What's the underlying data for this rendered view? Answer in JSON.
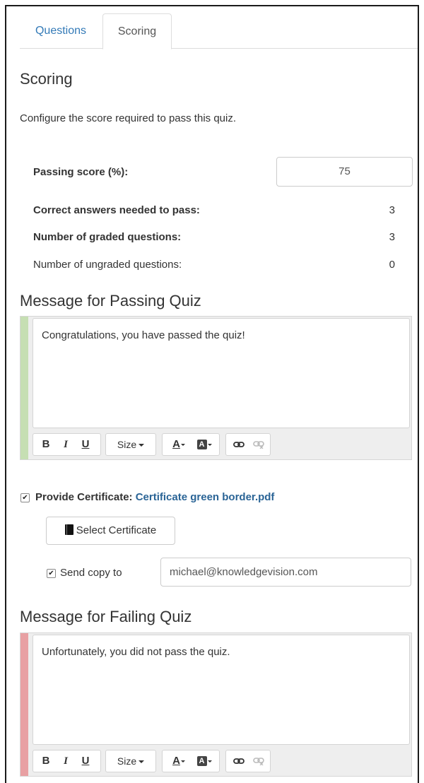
{
  "tabs": [
    {
      "label": "Questions",
      "active": false
    },
    {
      "label": "Scoring",
      "active": true
    }
  ],
  "scoring": {
    "title": "Scoring",
    "description": "Configure the score required to pass this quiz.",
    "passing_score_label": "Passing score (%):",
    "passing_score_value": "75",
    "correct_needed_label": "Correct answers needed to pass:",
    "correct_needed_value": "3",
    "graded_label": "Number of graded questions:",
    "graded_value": "3",
    "ungraded_label": "Number of ungraded questions:",
    "ungraded_value": "0"
  },
  "pass_message": {
    "title": "Message for Passing Quiz",
    "text": "Congratulations, you have passed the quiz!",
    "accent_color": "#c6dfb3"
  },
  "toolbar": {
    "bold": "B",
    "italic": "I",
    "underline": "U",
    "size": "Size",
    "font_color": "A",
    "bg_color": "A",
    "icons": [
      "bold-icon",
      "italic-icon",
      "underline-icon",
      "link-icon",
      "unlink-icon"
    ]
  },
  "certificate": {
    "checked": true,
    "label": "Provide Certificate:",
    "file": "Certificate green border.pdf",
    "select_button": "Select Certificate",
    "send_copy_checked": true,
    "send_copy_label": "Send copy to",
    "email": "michael@knowledgevision.com"
  },
  "fail_message": {
    "title": "Message for Failing Quiz",
    "text": "Unfortunately, you did not pass the quiz.",
    "accent_color": "#e8a0a3"
  },
  "colors": {
    "link": "#337ab7",
    "certificate_link": "#2a6496",
    "border": "#dddddd"
  }
}
